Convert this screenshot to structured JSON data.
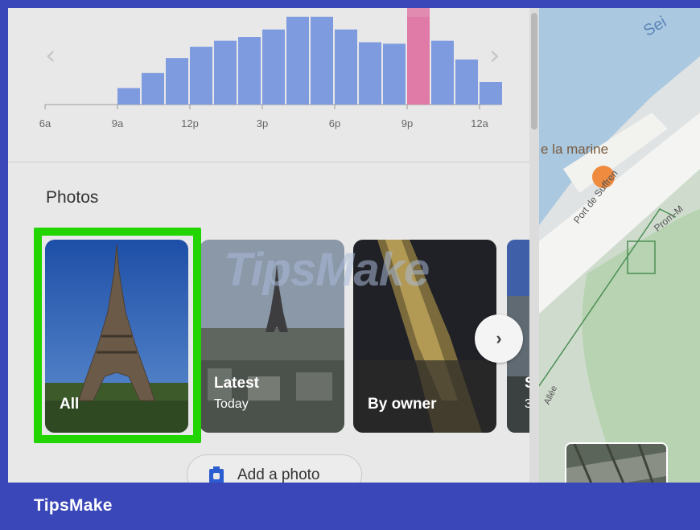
{
  "chart_data": {
    "type": "bar",
    "title": "",
    "xlabel": "",
    "ylabel": "",
    "tick_labels": [
      "6a",
      "9a",
      "12p",
      "3p",
      "6p",
      "9p",
      "12a"
    ],
    "hours": [
      "6a",
      "7a",
      "8a",
      "9a",
      "10a",
      "11a",
      "12p",
      "1p",
      "2p",
      "3p",
      "4p",
      "5p",
      "6p",
      "7p",
      "8p",
      "9p",
      "10p",
      "11p",
      "12a"
    ],
    "values": [
      0,
      0,
      0,
      22,
      42,
      62,
      77,
      85,
      90,
      100,
      117,
      117,
      100,
      83,
      81,
      117,
      85,
      60,
      30
    ],
    "ylim": [
      0,
      120
    ],
    "highlight_hour": "9p",
    "colors": {
      "bar": "#7e9be0",
      "highlight": "#e07aa6",
      "axis": "#9a9a9a"
    }
  },
  "panel": {
    "nav_prev_icon": "chevron-left-icon",
    "nav_next_icon": "chevron-right-icon",
    "photos_title": "Photos",
    "tiles": [
      {
        "label": "All",
        "sub": ""
      },
      {
        "label": "Latest",
        "sub": "Today"
      },
      {
        "label": "By owner",
        "sub": ""
      },
      {
        "label": "S",
        "sub": "3"
      }
    ],
    "watermark": "TipsMake",
    "add_photo_label": "Add a photo",
    "highlight_color": "#22d400"
  },
  "map": {
    "labels": {
      "seine": "Sei",
      "marine": "e la marine",
      "suffren": "Port de Suffren",
      "prom": "Prom-M",
      "allee": "Allée"
    }
  },
  "footer": {
    "brand": "TipsMake"
  }
}
